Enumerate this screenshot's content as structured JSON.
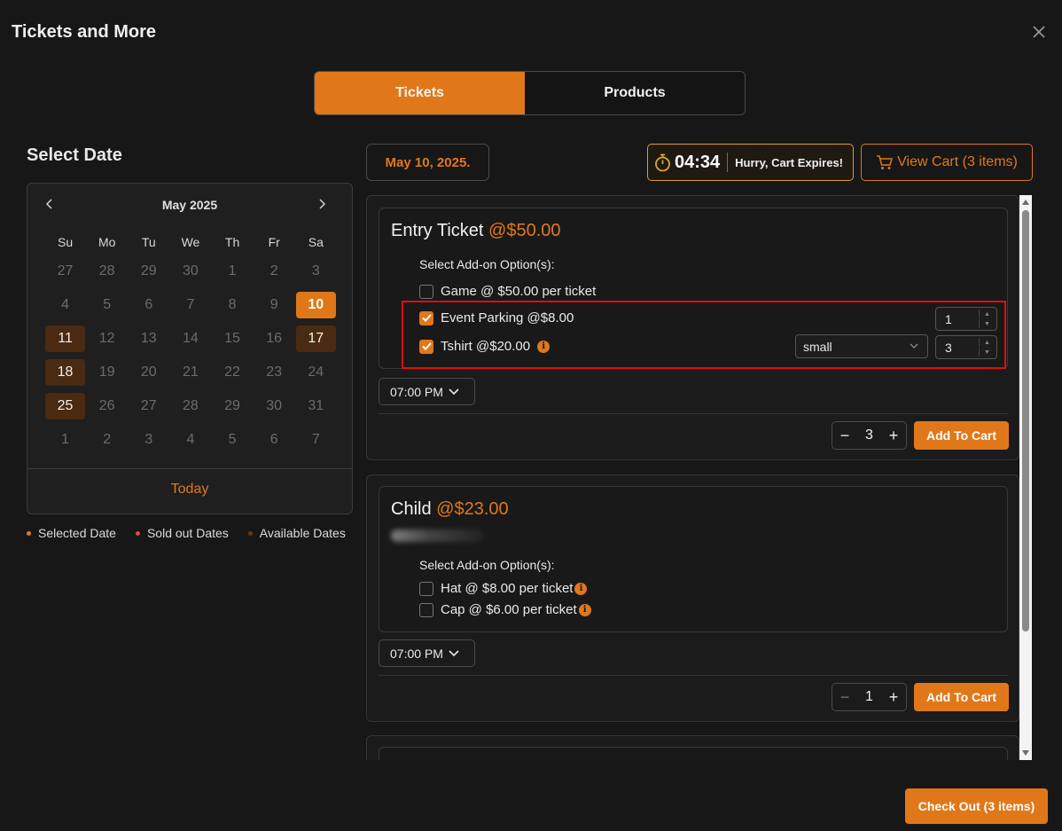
{
  "modal": {
    "title": "Tickets and More"
  },
  "tabs": [
    {
      "label": "Tickets",
      "active": true
    },
    {
      "label": "Products",
      "active": false
    }
  ],
  "calendar": {
    "heading": "Select Date",
    "month_label": "May 2025",
    "weekdays": [
      "Su",
      "Mo",
      "Tu",
      "We",
      "Th",
      "Fr",
      "Sa"
    ],
    "weeks": [
      [
        "27",
        "28",
        "29",
        "30",
        "1",
        "2",
        "3"
      ],
      [
        "4",
        "5",
        "6",
        "7",
        "8",
        "9",
        "10"
      ],
      [
        "11",
        "12",
        "13",
        "14",
        "15",
        "16",
        "17"
      ],
      [
        "18",
        "19",
        "20",
        "21",
        "22",
        "23",
        "24"
      ],
      [
        "25",
        "26",
        "27",
        "28",
        "29",
        "30",
        "31"
      ],
      [
        "1",
        "2",
        "3",
        "4",
        "5",
        "6",
        "7"
      ]
    ],
    "selected_day": "10",
    "available_days": [
      "11",
      "17",
      "18",
      "25"
    ],
    "today_label": "Today"
  },
  "legend": {
    "selected": "Selected Date",
    "sold_out": "Sold out Dates",
    "available": "Available Dates",
    "colors": {
      "selected": "#e0781a",
      "sold_out": "#e04848",
      "available": "#6a3a14"
    }
  },
  "header": {
    "selected_date": "May 10, 2025.",
    "timer": "04:34",
    "timer_message": "Hurry, Cart Expires!",
    "view_cart": "View Cart (3 items)"
  },
  "tickets": [
    {
      "name": "Entry Ticket",
      "price": "@$50.00",
      "addon_heading": "Select Add-on Option(s):",
      "addons": [
        {
          "label": "Game @ $50.00 per ticket",
          "checked": false
        },
        {
          "label": "Event Parking @$8.00",
          "checked": true,
          "qty": "1"
        },
        {
          "label": "Tshirt @$20.00",
          "checked": true,
          "info": true,
          "size": "small",
          "qty": "3"
        }
      ],
      "time": "07:00 PM",
      "quantity": "3",
      "add_label": "Add To Cart"
    },
    {
      "name": "Child",
      "price": "@$23.00",
      "addon_heading": "Select Add-on Option(s):",
      "addons": [
        {
          "label": "Hat @ $8.00 per ticket",
          "checked": false,
          "info": true
        },
        {
          "label": "Cap @ $6.00 per ticket",
          "checked": false,
          "info": true
        }
      ],
      "time": "07:00 PM",
      "quantity": "1",
      "add_label": "Add To Cart"
    }
  ],
  "footer": {
    "checkout": "Check Out (3 items)"
  },
  "colors": {
    "accent": "#e0781a",
    "background": "#171717",
    "highlight": "#e00e0e"
  }
}
